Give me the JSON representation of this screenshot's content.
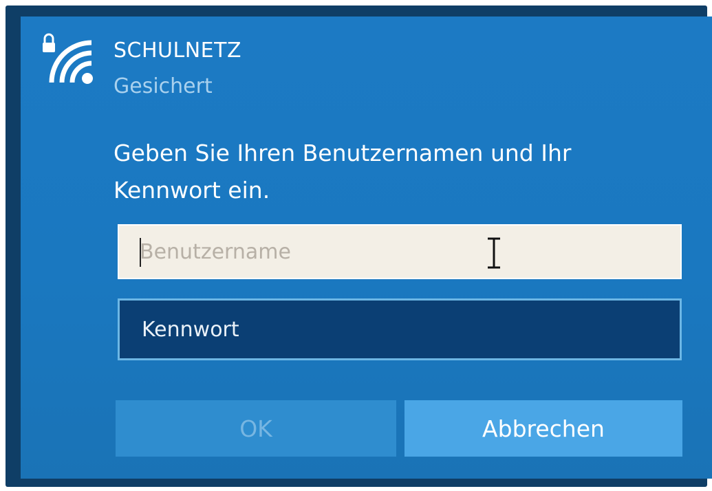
{
  "network": {
    "icon": "secured-wifi-icon",
    "name": "SCHULNETZ",
    "status": "Gesichert"
  },
  "prompt": "Geben Sie Ihren Benutzernamen und Ihr Kennwort ein.",
  "fields": {
    "username_placeholder": "Benutzername",
    "password_placeholder": "Kennwort"
  },
  "buttons": {
    "ok": "OK",
    "cancel": "Abbrechen"
  },
  "colors": {
    "dialog_bg": "#1a78c0",
    "frame": "#0f3e66",
    "password_field_bg": "#0b3f74",
    "cancel_button_bg": "#4aa6e6"
  }
}
